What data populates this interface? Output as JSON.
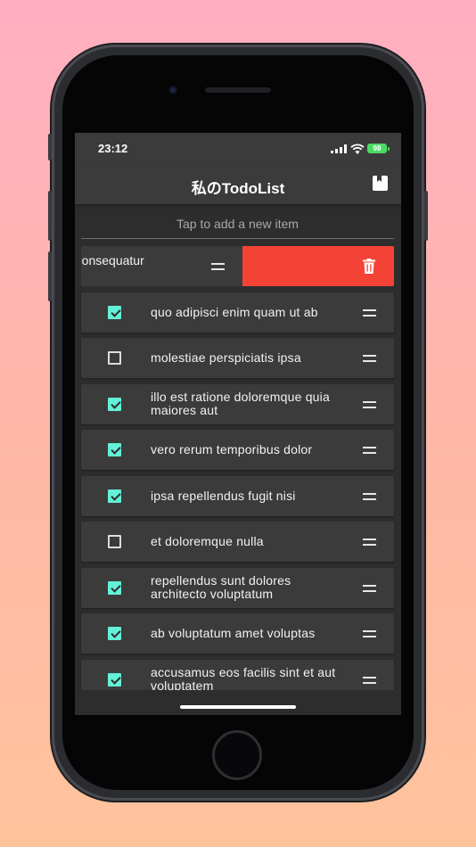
{
  "status": {
    "time": "23:12",
    "battery": "98"
  },
  "nav": {
    "title": "私のTodoList",
    "bookmark_icon": "bookmark-icon"
  },
  "add": {
    "placeholder": "Tap to add a new item"
  },
  "swiped": {
    "label": "a consequatur",
    "action": "delete",
    "action_icon": "trash-icon",
    "action_color": "#f44336"
  },
  "items": [
    {
      "label": "quo adipisci enim quam ut ab",
      "done": true
    },
    {
      "label": "molestiae perspiciatis ipsa",
      "done": false
    },
    {
      "label": "illo est ratione doloremque quia maiores aut",
      "done": true
    },
    {
      "label": "vero rerum temporibus dolor",
      "done": true
    },
    {
      "label": "ipsa repellendus fugit nisi",
      "done": true
    },
    {
      "label": "et doloremque nulla",
      "done": false
    },
    {
      "label": "repellendus sunt dolores architecto voluptatum",
      "done": true
    },
    {
      "label": "ab voluptatum amet voluptas",
      "done": true
    },
    {
      "label": "accusamus eos facilis sint et aut voluptatem",
      "done": true
    }
  ],
  "colors": {
    "accent": "#64f0d6",
    "row_bg": "#3b3b3b",
    "screen_bg": "#2d2d2d",
    "delete": "#f44336"
  }
}
